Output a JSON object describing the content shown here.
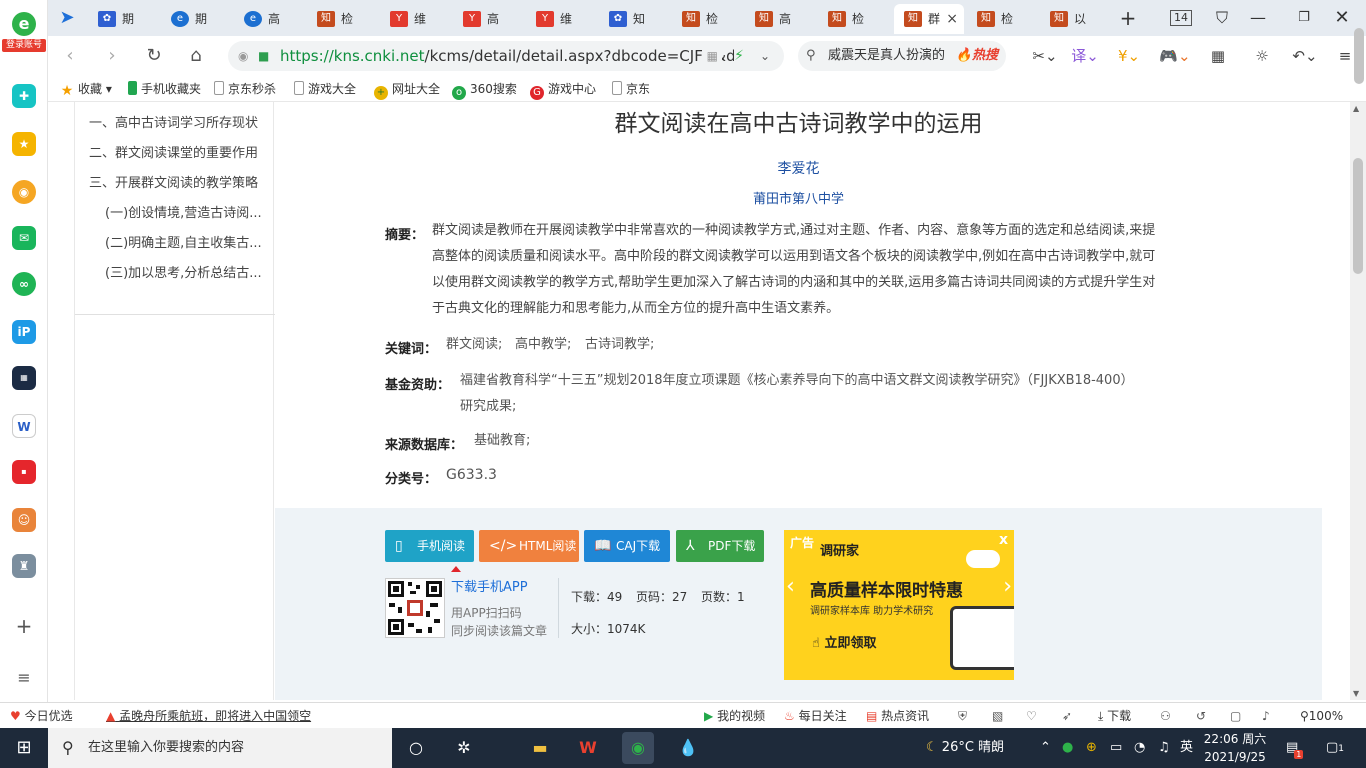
{
  "sidebar": {
    "login_label": "登录账号"
  },
  "tabs": [
    {
      "label": "期"
    },
    {
      "label": "期"
    },
    {
      "label": "高"
    },
    {
      "label": "检"
    },
    {
      "label": "维"
    },
    {
      "label": "高"
    },
    {
      "label": "维"
    },
    {
      "label": "知"
    },
    {
      "label": "检"
    },
    {
      "label": "高"
    },
    {
      "label": "检"
    },
    {
      "label": "群"
    },
    {
      "label": "检"
    },
    {
      "label": "以"
    }
  ],
  "tab_count": "14",
  "address": {
    "url_host": "https://kns.cnki.net",
    "url_path": "/kcms/detail/detail.aspx?dbcode=CJFD&d",
    "search_text": "威震天是真人扮演的",
    "search_hot": "热搜"
  },
  "bookmarks": [
    {
      "label": "收藏"
    },
    {
      "label": "手机收藏夹"
    },
    {
      "label": "京东秒杀"
    },
    {
      "label": "游戏大全"
    },
    {
      "label": "网址大全"
    },
    {
      "label": "360搜索"
    },
    {
      "label": "游戏中心"
    },
    {
      "label": "京东"
    }
  ],
  "toc": [
    {
      "label": "一、高中古诗词学习所存现状"
    },
    {
      "label": "二、群文阅读课堂的重要作用"
    },
    {
      "label": "三、开展群文阅读的教学策略"
    },
    {
      "label": "(一)创设情境,营造古诗阅..."
    },
    {
      "label": "(二)明确主题,自主收集古..."
    },
    {
      "label": "(三)加以思考,分析总结古..."
    }
  ],
  "article": {
    "title": "群文阅读在高中古诗词教学中的运用",
    "author": "李爱花",
    "org": "莆田市第八中学",
    "abstract_label": "摘要：",
    "abstract_lines": [
      "群文阅读是教师在开展阅读教学中非常喜欢的一种阅读教学方式,通过对主题、作者、内容、意象等方面的选定和总结阅读,来提",
      "高整体的阅读质量和阅读水平。高中阶段的群文阅读教学可以运用到语文各个板块的阅读教学中,例如在高中古诗词教学中,就可",
      "以使用群文阅读教学的教学方式,帮助学生更加深入了解古诗词的内涵和其中的关联,运用多篇古诗词共同阅读的方式提升学生对",
      "于古典文化的理解能力和思考能力,从而全方位的提升高中生语文素养。"
    ],
    "keywords_label": "关键词：",
    "keywords": [
      "群文阅读;",
      "高中教学;",
      "古诗词教学;"
    ],
    "fund_label": "基金资助：",
    "fund_lines": [
      "福建省教育科学“十三五”规划2018年度立项课题《核心素养导向下的高中语文群文阅读教学研究》（FJJKXB18-400）",
      "研究成果;"
    ],
    "source_label": "来源数据库：",
    "source": "基础教育;",
    "class_label": "分类号：",
    "class_code": "G633.3"
  },
  "actions": {
    "mobile_read": "手机阅读",
    "html_read": "HTML阅读",
    "caj_download": "CAJ下载",
    "pdf_download": "PDF下载",
    "app_download": "下载手机APP",
    "scan_line1": "用APP扫扫码",
    "scan_line2": "同步阅读该篇文章",
    "downloads": "下载：49",
    "page_code": "页码：27",
    "page_count": "页数：1",
    "size": "大小：1074K"
  },
  "ad": {
    "tag": "广告",
    "brand": "调研家",
    "headline": "高质量样本限时特惠",
    "sub": "调研家样本库 助力学术研究",
    "cta": "立即领取",
    "close": "x"
  },
  "statusbar": {
    "left1": "今日优选",
    "left2": "孟晚舟所乘航班，即将进入中国领空",
    "video": "我的视频",
    "follow": "每日关注",
    "news": "热点资讯",
    "download": "下载",
    "zoom": "100%"
  },
  "taskbar": {
    "search_placeholder": "在这里输入你要搜索的内容",
    "weather": "26°C 晴朗",
    "ime": "英",
    "time": "22:06 周六",
    "date": "2021/9/25",
    "notify_count": "1"
  },
  "colors": {
    "btn_mobile": "#1fa3c7",
    "btn_html": "#f0813e",
    "btn_caj": "#1f87d6",
    "btn_pdf": "#3aa24a",
    "ad_bg": "#ffd21d"
  }
}
